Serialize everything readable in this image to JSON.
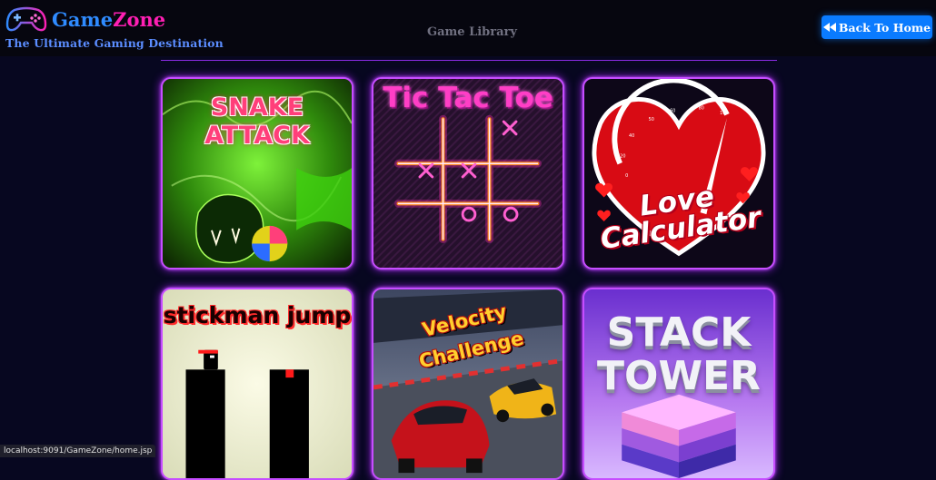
{
  "header": {
    "brand_part1": "Game",
    "brand_part2": "Zone",
    "tagline": "The Ultimate Gaming Destination",
    "page_title": "Game Library",
    "back_button_label": "Back To Home",
    "back_button_icon": "backward-icon"
  },
  "games": [
    {
      "title_line1": "SNAKE",
      "title_line2": "ATTACK",
      "accent": "#39ff14"
    },
    {
      "title": "Tic Tac Toe",
      "accent": "#ff3ec6"
    },
    {
      "title_line1": "Love",
      "title_line2": "Calculator",
      "accent": "#ff1f1f"
    },
    {
      "title": "stickman jump",
      "accent": "#ff2b2b"
    },
    {
      "title_line1": "Velocity",
      "title_line2": "Challenge",
      "accent": "#ffcf2e"
    },
    {
      "title_line1": "STACK",
      "title_line2": "TOWER",
      "accent": "#b48cff"
    }
  ],
  "status_bar": {
    "url": "localhost:9091/GameZone/home.jsp"
  },
  "colors": {
    "brand_blue": "#2f8bff",
    "brand_pink": "#ff1fb4",
    "button_blue": "#0a7bff",
    "card_glow": "#a020f0"
  }
}
